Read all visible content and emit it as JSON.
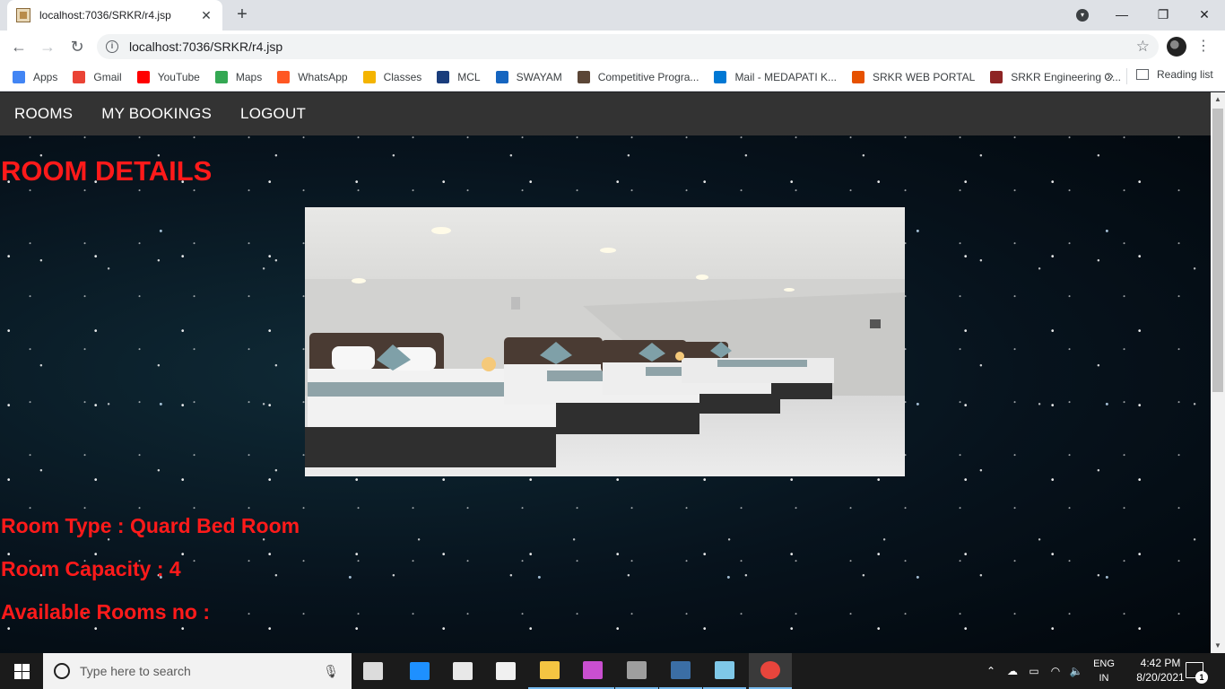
{
  "browser": {
    "tab_title": "localhost:7036/SRKR/r4.jsp",
    "tab_close": "✕",
    "new_tab": "+",
    "url": "localhost:7036/SRKR/r4.jsp",
    "window_controls": {
      "minimize": "—",
      "restore": "❐",
      "close": "✕"
    },
    "bookmarks": [
      {
        "label": "Apps",
        "icon": "apps-grid-icon",
        "color": "#4285f4"
      },
      {
        "label": "Gmail",
        "icon": "gmail-icon",
        "color": "#ea4335"
      },
      {
        "label": "YouTube",
        "icon": "youtube-icon",
        "color": "#ff0000"
      },
      {
        "label": "Maps",
        "icon": "maps-icon",
        "color": "#34a853"
      },
      {
        "label": "WhatsApp",
        "icon": "whatsapp-icon",
        "color": "#ff5722"
      },
      {
        "label": "Classes",
        "icon": "classroom-icon",
        "color": "#f4b400"
      },
      {
        "label": "MCL",
        "icon": "mcl-icon",
        "color": "#1a3d7c"
      },
      {
        "label": "SWAYAM",
        "icon": "swayam-icon",
        "color": "#1565c0"
      },
      {
        "label": "Competitive Progra...",
        "icon": "cc-icon",
        "color": "#5b4636"
      },
      {
        "label": "Mail - MEDAPATI K...",
        "icon": "outlook-icon",
        "color": "#0078d4"
      },
      {
        "label": "SRKR WEB PORTAL",
        "icon": "srkr-portal-icon",
        "color": "#e65100"
      },
      {
        "label": "SRKR Engineering C...",
        "icon": "srkr-college-icon",
        "color": "#8e2424"
      }
    ],
    "bookmarks_more": "»",
    "reading_list": "Reading list"
  },
  "page": {
    "nav": [
      "ROOMS",
      "MY BOOKINGS",
      "LOGOUT"
    ],
    "heading": "ROOM DETAILS",
    "room_type_line": "Room Type : Quard Bed Room",
    "room_capacity_line": "Room Capacity : 4",
    "available_rooms_line": "Available Rooms no :"
  },
  "taskbar": {
    "search_placeholder": "Type here to search",
    "apps": [
      "task-view-icon",
      "edge-icon",
      "store-icon",
      "mail-icon",
      "file-explorer-icon",
      "paint-icon",
      "magnifier-icon",
      "mysql-workbench-icon",
      "notepad-icon",
      "chrome-icon"
    ],
    "language": "ENG",
    "region": "IN",
    "time": "4:42 PM",
    "date": "8/20/2021",
    "notification_count": "1"
  }
}
